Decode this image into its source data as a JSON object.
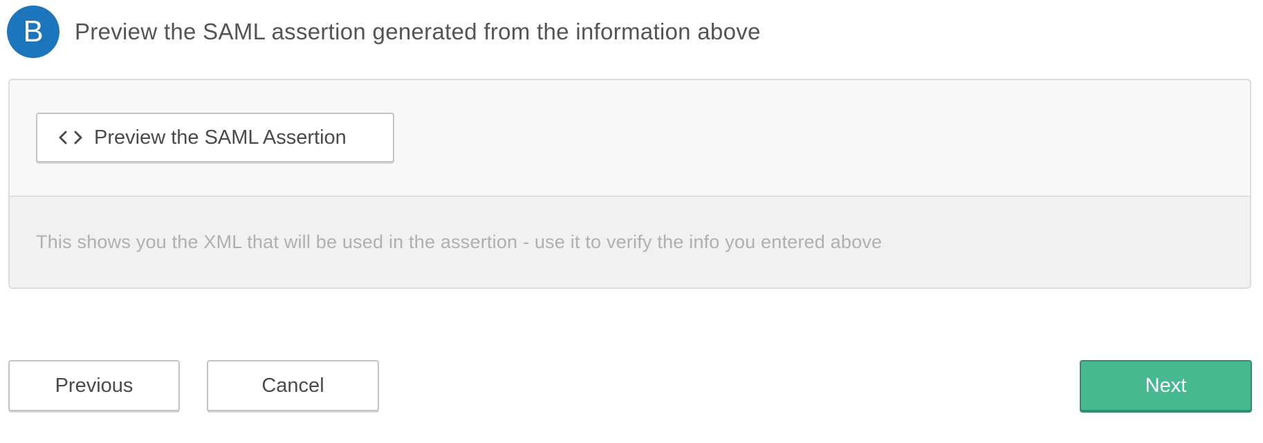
{
  "step": {
    "badge": "B",
    "title": "Preview the SAML assertion generated from the information above"
  },
  "panel": {
    "preview_button_label": "Preview the SAML Assertion",
    "preview_button_icon": "code-icon",
    "hint": "This shows you the XML that will be used in the assertion - use it to verify the info you entered above"
  },
  "footer": {
    "previous_label": "Previous",
    "cancel_label": "Cancel",
    "next_label": "Next"
  },
  "colors": {
    "badge_blue": "#1d75bb",
    "next_green": "#46b990"
  }
}
